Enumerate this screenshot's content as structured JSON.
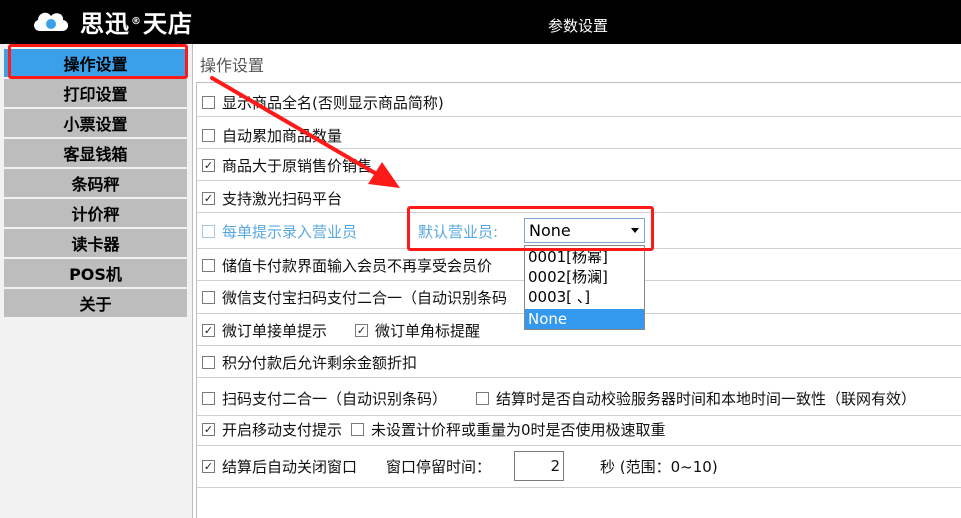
{
  "brand": {
    "name_part1": "思迅",
    "reg": "®",
    "name_part2": "天店"
  },
  "window": {
    "title": "参数设置"
  },
  "sidebar": {
    "items": [
      {
        "label": "操作设置"
      },
      {
        "label": "打印设置"
      },
      {
        "label": "小票设置"
      },
      {
        "label": "客显钱箱"
      },
      {
        "label": "条码秤"
      },
      {
        "label": "计价秤"
      },
      {
        "label": "读卡器"
      },
      {
        "label": "POS机"
      },
      {
        "label": "关于"
      }
    ]
  },
  "main": {
    "section_title": "操作设置",
    "options": {
      "show_full_name": {
        "label": "显示商品全名(否则显示商品简称)",
        "checked": false
      },
      "auto_accumulate": {
        "label": "自动累加商品数量",
        "checked": false
      },
      "price_over_original": {
        "label": "商品大于原销售价销售",
        "checked": true
      },
      "laser_scan": {
        "label": "支持激光扫码平台",
        "checked": true
      },
      "prompt_salesperson": {
        "label": "每单提示录入营业员",
        "checked": false
      },
      "stored_card_no_member": {
        "label": "储值卡付款界面输入会员不再享受会员价",
        "checked": false
      },
      "wechat_alipay_2in1": {
        "label": "微信支付宝扫码支付二合一（自动识别条码",
        "checked": false
      },
      "micro_order_prompt": {
        "label": "微订单接单提示",
        "checked": true
      },
      "micro_order_badge": {
        "label": "微订单角标提醒",
        "checked": true
      },
      "points_allow_discount": {
        "label": "积分付款后允许剩余金额折扣",
        "checked": false
      },
      "scan_pay_2in1": {
        "label": "扫码支付二合一（自动识别条码）",
        "checked": false
      },
      "auto_check_time": {
        "label": "结算时是否自动校验服务器时间和本地时间一致性（联网有效）",
        "checked": false
      },
      "mobile_pay_prompt": {
        "label": "开启移动支付提示",
        "checked": true
      },
      "fast_weigh": {
        "label": "未设置计价秤或重量为0时是否使用极速取重",
        "checked": false
      },
      "auto_close_window": {
        "label": "结算后自动关闭窗口",
        "checked": true
      }
    },
    "salesperson": {
      "label": "默认营业员:",
      "selected": "None",
      "options": [
        "0001[杨幂]",
        "0002[杨澜]",
        "0003[ 、]",
        "None"
      ]
    },
    "window_stay": {
      "label": "窗口停留时间：",
      "value": "2",
      "suffix": "秒 (范围：0~10)"
    }
  },
  "colors": {
    "accent": "#3aa0ea",
    "highlight": "#ff1a1a",
    "header": "#000000"
  }
}
